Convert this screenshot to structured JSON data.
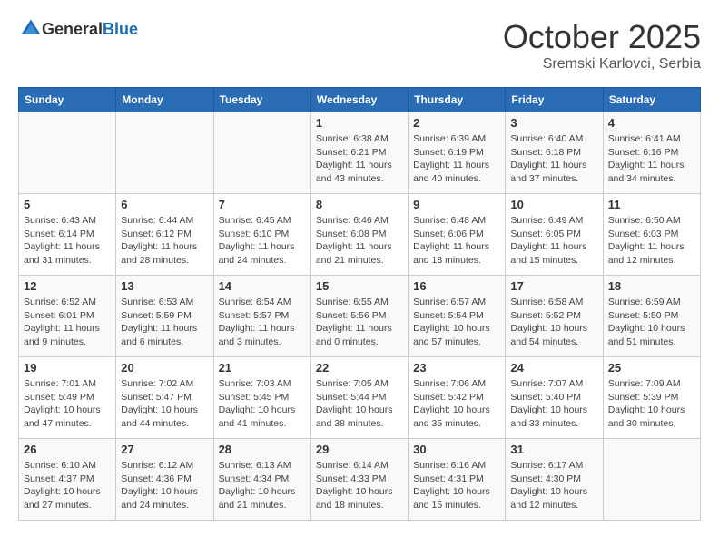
{
  "header": {
    "logo_general": "General",
    "logo_blue": "Blue",
    "month_title": "October 2025",
    "subtitle": "Sremski Karlovci, Serbia"
  },
  "days_of_week": [
    "Sunday",
    "Monday",
    "Tuesday",
    "Wednesday",
    "Thursday",
    "Friday",
    "Saturday"
  ],
  "weeks": [
    [
      {
        "day": "",
        "info": ""
      },
      {
        "day": "",
        "info": ""
      },
      {
        "day": "",
        "info": ""
      },
      {
        "day": "1",
        "info": "Sunrise: 6:38 AM\nSunset: 6:21 PM\nDaylight: 11 hours\nand 43 minutes."
      },
      {
        "day": "2",
        "info": "Sunrise: 6:39 AM\nSunset: 6:19 PM\nDaylight: 11 hours\nand 40 minutes."
      },
      {
        "day": "3",
        "info": "Sunrise: 6:40 AM\nSunset: 6:18 PM\nDaylight: 11 hours\nand 37 minutes."
      },
      {
        "day": "4",
        "info": "Sunrise: 6:41 AM\nSunset: 6:16 PM\nDaylight: 11 hours\nand 34 minutes."
      }
    ],
    [
      {
        "day": "5",
        "info": "Sunrise: 6:43 AM\nSunset: 6:14 PM\nDaylight: 11 hours\nand 31 minutes."
      },
      {
        "day": "6",
        "info": "Sunrise: 6:44 AM\nSunset: 6:12 PM\nDaylight: 11 hours\nand 28 minutes."
      },
      {
        "day": "7",
        "info": "Sunrise: 6:45 AM\nSunset: 6:10 PM\nDaylight: 11 hours\nand 24 minutes."
      },
      {
        "day": "8",
        "info": "Sunrise: 6:46 AM\nSunset: 6:08 PM\nDaylight: 11 hours\nand 21 minutes."
      },
      {
        "day": "9",
        "info": "Sunrise: 6:48 AM\nSunset: 6:06 PM\nDaylight: 11 hours\nand 18 minutes."
      },
      {
        "day": "10",
        "info": "Sunrise: 6:49 AM\nSunset: 6:05 PM\nDaylight: 11 hours\nand 15 minutes."
      },
      {
        "day": "11",
        "info": "Sunrise: 6:50 AM\nSunset: 6:03 PM\nDaylight: 11 hours\nand 12 minutes."
      }
    ],
    [
      {
        "day": "12",
        "info": "Sunrise: 6:52 AM\nSunset: 6:01 PM\nDaylight: 11 hours\nand 9 minutes."
      },
      {
        "day": "13",
        "info": "Sunrise: 6:53 AM\nSunset: 5:59 PM\nDaylight: 11 hours\nand 6 minutes."
      },
      {
        "day": "14",
        "info": "Sunrise: 6:54 AM\nSunset: 5:57 PM\nDaylight: 11 hours\nand 3 minutes."
      },
      {
        "day": "15",
        "info": "Sunrise: 6:55 AM\nSunset: 5:56 PM\nDaylight: 11 hours\nand 0 minutes."
      },
      {
        "day": "16",
        "info": "Sunrise: 6:57 AM\nSunset: 5:54 PM\nDaylight: 10 hours\nand 57 minutes."
      },
      {
        "day": "17",
        "info": "Sunrise: 6:58 AM\nSunset: 5:52 PM\nDaylight: 10 hours\nand 54 minutes."
      },
      {
        "day": "18",
        "info": "Sunrise: 6:59 AM\nSunset: 5:50 PM\nDaylight: 10 hours\nand 51 minutes."
      }
    ],
    [
      {
        "day": "19",
        "info": "Sunrise: 7:01 AM\nSunset: 5:49 PM\nDaylight: 10 hours\nand 47 minutes."
      },
      {
        "day": "20",
        "info": "Sunrise: 7:02 AM\nSunset: 5:47 PM\nDaylight: 10 hours\nand 44 minutes."
      },
      {
        "day": "21",
        "info": "Sunrise: 7:03 AM\nSunset: 5:45 PM\nDaylight: 10 hours\nand 41 minutes."
      },
      {
        "day": "22",
        "info": "Sunrise: 7:05 AM\nSunset: 5:44 PM\nDaylight: 10 hours\nand 38 minutes."
      },
      {
        "day": "23",
        "info": "Sunrise: 7:06 AM\nSunset: 5:42 PM\nDaylight: 10 hours\nand 35 minutes."
      },
      {
        "day": "24",
        "info": "Sunrise: 7:07 AM\nSunset: 5:40 PM\nDaylight: 10 hours\nand 33 minutes."
      },
      {
        "day": "25",
        "info": "Sunrise: 7:09 AM\nSunset: 5:39 PM\nDaylight: 10 hours\nand 30 minutes."
      }
    ],
    [
      {
        "day": "26",
        "info": "Sunrise: 6:10 AM\nSunset: 4:37 PM\nDaylight: 10 hours\nand 27 minutes."
      },
      {
        "day": "27",
        "info": "Sunrise: 6:12 AM\nSunset: 4:36 PM\nDaylight: 10 hours\nand 24 minutes."
      },
      {
        "day": "28",
        "info": "Sunrise: 6:13 AM\nSunset: 4:34 PM\nDaylight: 10 hours\nand 21 minutes."
      },
      {
        "day": "29",
        "info": "Sunrise: 6:14 AM\nSunset: 4:33 PM\nDaylight: 10 hours\nand 18 minutes."
      },
      {
        "day": "30",
        "info": "Sunrise: 6:16 AM\nSunset: 4:31 PM\nDaylight: 10 hours\nand 15 minutes."
      },
      {
        "day": "31",
        "info": "Sunrise: 6:17 AM\nSunset: 4:30 PM\nDaylight: 10 hours\nand 12 minutes."
      },
      {
        "day": "",
        "info": ""
      }
    ]
  ]
}
